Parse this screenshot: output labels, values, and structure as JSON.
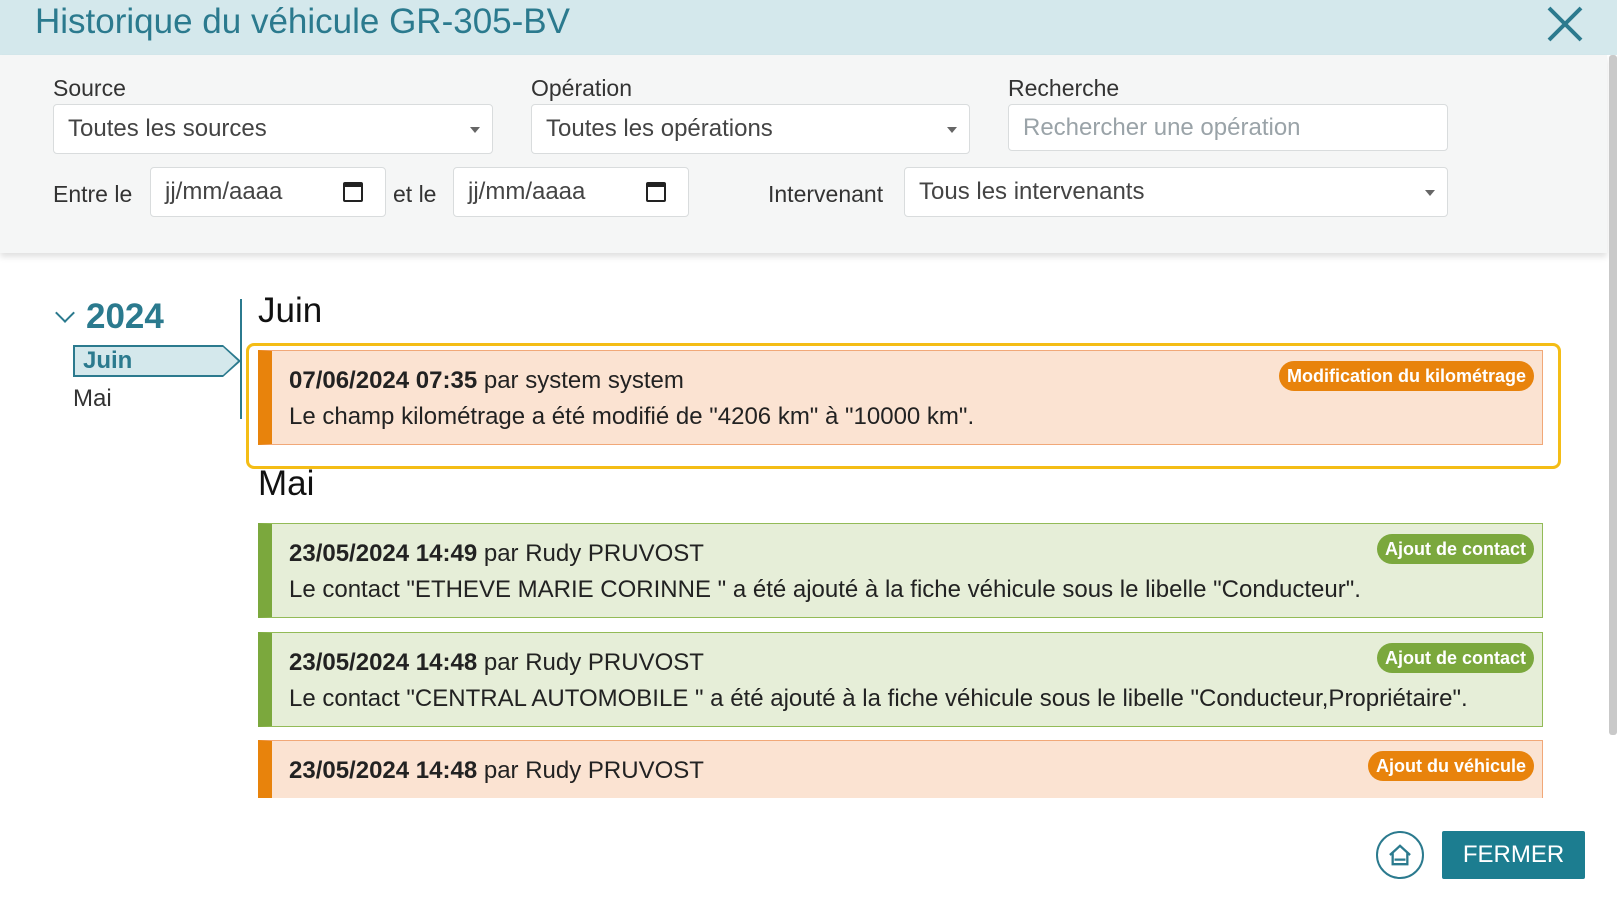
{
  "header": {
    "title": "Historique du véhicule GR-305-BV"
  },
  "filters": {
    "source": {
      "label": "Source",
      "value": "Toutes les sources"
    },
    "operation": {
      "label": "Opération",
      "value": "Toutes les opérations"
    },
    "search": {
      "label": "Recherche",
      "placeholder": "Rechercher une opération"
    },
    "between_label": "Entre le",
    "date_from": "jj/mm/aaaa",
    "and_label": "et le",
    "date_to": "jj/mm/aaaa",
    "intervenant": {
      "label": "Intervenant",
      "value": "Tous les intervenants"
    }
  },
  "nav": {
    "year": "2024",
    "months": [
      "Juin",
      "Mai"
    ]
  },
  "sections": [
    {
      "month": "Juin"
    },
    {
      "month": "Mai"
    }
  ],
  "entries": [
    {
      "date": "07/06/2024 07:35",
      "by": "par system system",
      "text": "Le champ kilométrage a été modifié de \"4206 km\" à \"10000 km\".",
      "badge": "Modification du kilométrage",
      "color": "#e8830c"
    },
    {
      "date": "23/05/2024 14:49",
      "by": "par Rudy PRUVOST",
      "text": "Le contact \"ETHEVE MARIE CORINNE \" a été ajouté à la fiche véhicule sous le libelle \"Conducteur\".",
      "badge": "Ajout de contact",
      "color": "#7ba83d"
    },
    {
      "date": "23/05/2024 14:48",
      "by": "par Rudy PRUVOST",
      "text": "Le contact \"CENTRAL AUTOMOBILE \" a été ajouté à la fiche véhicule sous le libelle \"Conducteur,Propriétaire\".",
      "badge": "Ajout de contact",
      "color": "#7ba83d"
    },
    {
      "date": "23/05/2024 14:48",
      "by": "par Rudy PRUVOST",
      "text": "",
      "badge": "Ajout du véhicule",
      "color": "#e8830c"
    }
  ],
  "footer": {
    "close_label": "FERMER"
  },
  "icons": [
    "close-icon",
    "chevron-down-icon",
    "calendar-icon",
    "home-icon"
  ]
}
